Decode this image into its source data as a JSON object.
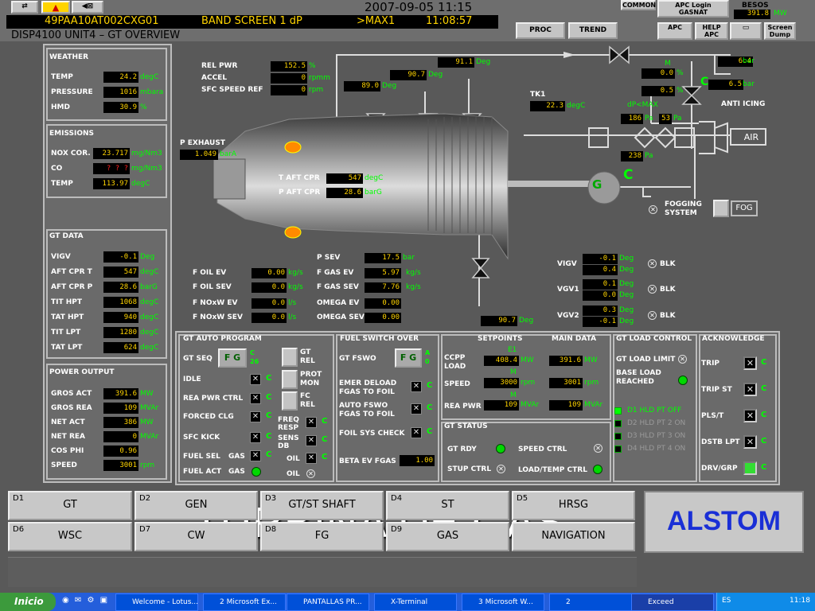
{
  "header": {
    "date": "2007-09-05 11:15",
    "tag": "49PAA10AT002CXG01",
    "band": "BAND SCREEN 1 dP",
    "max": ">MAX1",
    "time": "11:08:57",
    "disp": "DISP4100  UNIT4 – GT OVERVIEW",
    "common": "COMMON",
    "apc_login": "APC Login",
    "gasnat": "GASNAT",
    "besos": "BESOS",
    "besos_val": "391.8",
    "besos_unit": "MW",
    "proc": "PROC",
    "trend": "TREND",
    "apc": "APC",
    "help_apc": "HELP APC",
    "screen_dump": "Screen Dump"
  },
  "weather": {
    "title": "WEATHER",
    "rows": [
      {
        "l": "TEMP",
        "v": "24.2",
        "u": "degC"
      },
      {
        "l": "PRESSURE",
        "v": "1016",
        "u": "mbara"
      },
      {
        "l": "HMD",
        "v": "30.9",
        "u": "%"
      }
    ]
  },
  "emissions": {
    "title": "EMISSIONS",
    "rows": [
      {
        "l": "NOX COR.",
        "v": "23.717",
        "u": "mg/Nm3"
      },
      {
        "l": "CO",
        "v": "? ? ?",
        "u": "mg/Nm3"
      },
      {
        "l": "TEMP",
        "v": "113.97",
        "u": "degC"
      }
    ]
  },
  "gtdata": {
    "title": "GT DATA",
    "rows": [
      {
        "l": "VIGV",
        "v": "-0.1",
        "u": "Deg"
      },
      {
        "l": "AFT CPR T",
        "v": "547",
        "u": "degC"
      },
      {
        "l": "AFT CPR P",
        "v": "28.6",
        "u": "barG"
      },
      {
        "l": "TIT HPT",
        "v": "1068",
        "u": "degC"
      },
      {
        "l": "TAT HPT",
        "v": "940",
        "u": "degC"
      },
      {
        "l": "TIT LPT",
        "v": "1280",
        "u": "degC"
      },
      {
        "l": "TAT LPT",
        "v": "624",
        "u": "degC"
      }
    ]
  },
  "power": {
    "title": "POWER OUTPUT",
    "rows": [
      {
        "l": "GROS ACT",
        "v": "391.6",
        "u": "MW"
      },
      {
        "l": "GROS REA",
        "v": "109",
        "u": "MVAr"
      },
      {
        "l": "NET ACT",
        "v": "386",
        "u": "MW"
      },
      {
        "l": "NET REA",
        "v": "0",
        "u": "MVAr"
      },
      {
        "l": "COS PHI",
        "v": "0.96",
        "u": ""
      },
      {
        "l": "SPEED",
        "v": "3001",
        "u": "rpm"
      }
    ]
  },
  "diagram": {
    "rel_pwr": {
      "l": "REL PWR",
      "v": "152.5",
      "u": "%"
    },
    "accel": {
      "l": "ACCEL",
      "v": "0",
      "u": "rpmm"
    },
    "sfc": {
      "l": "SFC SPEED REF",
      "v": "0",
      "u": "rpm"
    },
    "deg1": "91.1",
    "deg2": "90.7",
    "deg3": "89.0",
    "deg_u": "Deg",
    "tk1": "TK1",
    "tk1_v": "22.3",
    "tk1_u": "degC",
    "m_lbl": "M",
    "m1": "0.0",
    "m2": "0.5",
    "pct": "%",
    "bar1": "6.4",
    "bar2": "6.5",
    "bar_u": "bar",
    "c": "C",
    "anti": "ANTI  ICING",
    "dp": "dP<MAX",
    "pa1": "186",
    "pa2": "53",
    "pa3": "238",
    "pa_u": "Pa",
    "air": "AIR",
    "pexh": "P EXHAUST",
    "pexh_v": "1.049",
    "pexh_u": "barA",
    "taft": "T AFT CPR",
    "taft_v": "547",
    "taft_u": "degC",
    "paft": "P AFT CPR",
    "paft_v": "28.6",
    "paft_u": "barG",
    "g": "G",
    "fogging": "FOGGING SYSTEM",
    "fog": "FOG",
    "psev": "P SEV",
    "psev_v": "17.5",
    "psev_u": "bar",
    "foilev": {
      "l": "F OIL EV",
      "v": "0.00",
      "u": "kg/s"
    },
    "foilsev": {
      "l": "F OIL SEV",
      "v": "0.0",
      "u": "kg/s"
    },
    "fnoxev": {
      "l": "F NOxW EV",
      "v": "0.0",
      "u": "l/s"
    },
    "fnoxsev": {
      "l": "F NOxW SEV",
      "v": "0.0",
      "u": "l/s"
    },
    "fgasev": {
      "l": "F GAS EV",
      "v": "5.97",
      "u": "kg/s"
    },
    "fgassev": {
      "l": "F GAS SEV",
      "v": "7.76",
      "u": "kg/s"
    },
    "omegaev": {
      "l": "OMEGA EV",
      "v": "0.00"
    },
    "omegasev": {
      "l": "OMEGA SEV",
      "v": "0.00"
    },
    "bot_deg": "90.7",
    "vigv": "VIGV",
    "vigv1": "-0.1",
    "vigv2": "0.4",
    "vgv1": "VGV1",
    "vgv1a": "0.1",
    "vgv1b": "0.0",
    "vgv2": "VGV2",
    "vgv2a": "0.3",
    "vgv2b": "-0.1",
    "blk": "BLK"
  },
  "autoprog": {
    "title": "GT AUTO PROGRAM",
    "gtseq": "GT SEQ",
    "fg": "F G",
    "c26": "C 26",
    "idle": "IDLE",
    "rea": "REA PWR CTRL",
    "forced": "FORCED CLG",
    "sfc": "SFC KICK",
    "fuelsel": "FUEL SEL",
    "fuelact": "FUEL ACT",
    "gas": "GAS",
    "gtrel": "GT REL",
    "protmon": "PROT MON",
    "fcrel": "FC REL",
    "freq": "FREQ RESP",
    "sens": "SENS DB",
    "oil": "OIL",
    "c": "C"
  },
  "fuelsw": {
    "title": "FUEL SWITCH OVER",
    "fswo": "GT FSWO",
    "fg": "F G",
    "a0": "A 0",
    "emer": "EMER DELOAD FGAS TO FOIL",
    "auto": "AUTO FSWO FGAS TO FOIL",
    "foil": "FOIL SYS CHECK",
    "beta": "BETA EV FGAS",
    "beta_v": "1.00",
    "c": "C"
  },
  "setpoints": {
    "title": "SETPOINTS",
    "main": "MAIN DATA",
    "ccpp": "CCPP LOAD",
    "e1": "E1",
    "load_sp": "408.4",
    "load_md": "391.6",
    "mw": "MW",
    "speed": "SPEED",
    "m": "M",
    "speed_sp": "3000",
    "speed_md": "3001",
    "rpm": "rpm",
    "reapwr": "REA PWR",
    "rea_sp": "109",
    "rea_md": "109",
    "mvar": "MVAr"
  },
  "gtstatus": {
    "title": "GT STATUS",
    "rdy": "GT RDY",
    "stup": "STUP CTRL",
    "speed": "SPEED CTRL",
    "load": "LOAD/TEMP CTRL"
  },
  "loadctrl": {
    "title": "GT LOAD CONTROL",
    "limit": "GT LOAD LIMIT",
    "base": "BASE LOAD REACHED",
    "d1": "D1 HLD PT OFF",
    "d2": "D2 HLD PT 2 ON",
    "d3": "D3 HLD PT 3 ON",
    "d4": "D4 HLD PT 4 ON"
  },
  "ack": {
    "title": "ACKNOWLEDGE",
    "items": [
      "TRIP",
      "TRIP ST",
      "PLS/T",
      "DSTB LPT",
      "DRV/GRP"
    ],
    "c": "C"
  },
  "nav": [
    {
      "code": "D1",
      "t": "GT"
    },
    {
      "code": "D2",
      "t": "GEN"
    },
    {
      "code": "D3",
      "t": "GT/ST SHAFT"
    },
    {
      "code": "D4",
      "t": "ST"
    },
    {
      "code": "D5",
      "t": "HRSG"
    },
    {
      "code": "D6",
      "t": "WSC"
    },
    {
      "code": "D7",
      "t": "CW"
    },
    {
      "code": "D8",
      "t": "FG"
    },
    {
      "code": "D9",
      "t": "GAS"
    },
    {
      "code": "",
      "t": "NAVIGATION"
    }
  ],
  "overlay": "TURBINA DE GAS",
  "logo": "ALSTOM",
  "taskbar": {
    "start": "Inicio",
    "items": [
      "Welcome - Lotus...",
      "2 Microsoft Ex...",
      "PANTALLAS PR...",
      "X-Terminal",
      "3 Microsoft W...",
      "2",
      "Exceed"
    ],
    "lang": "ES",
    "clock": "11:18"
  },
  "colors": {
    "green": "#00ff00",
    "yellow": "#ffd400",
    "bg": "#595959",
    "alstom": "#1a2fd6"
  }
}
